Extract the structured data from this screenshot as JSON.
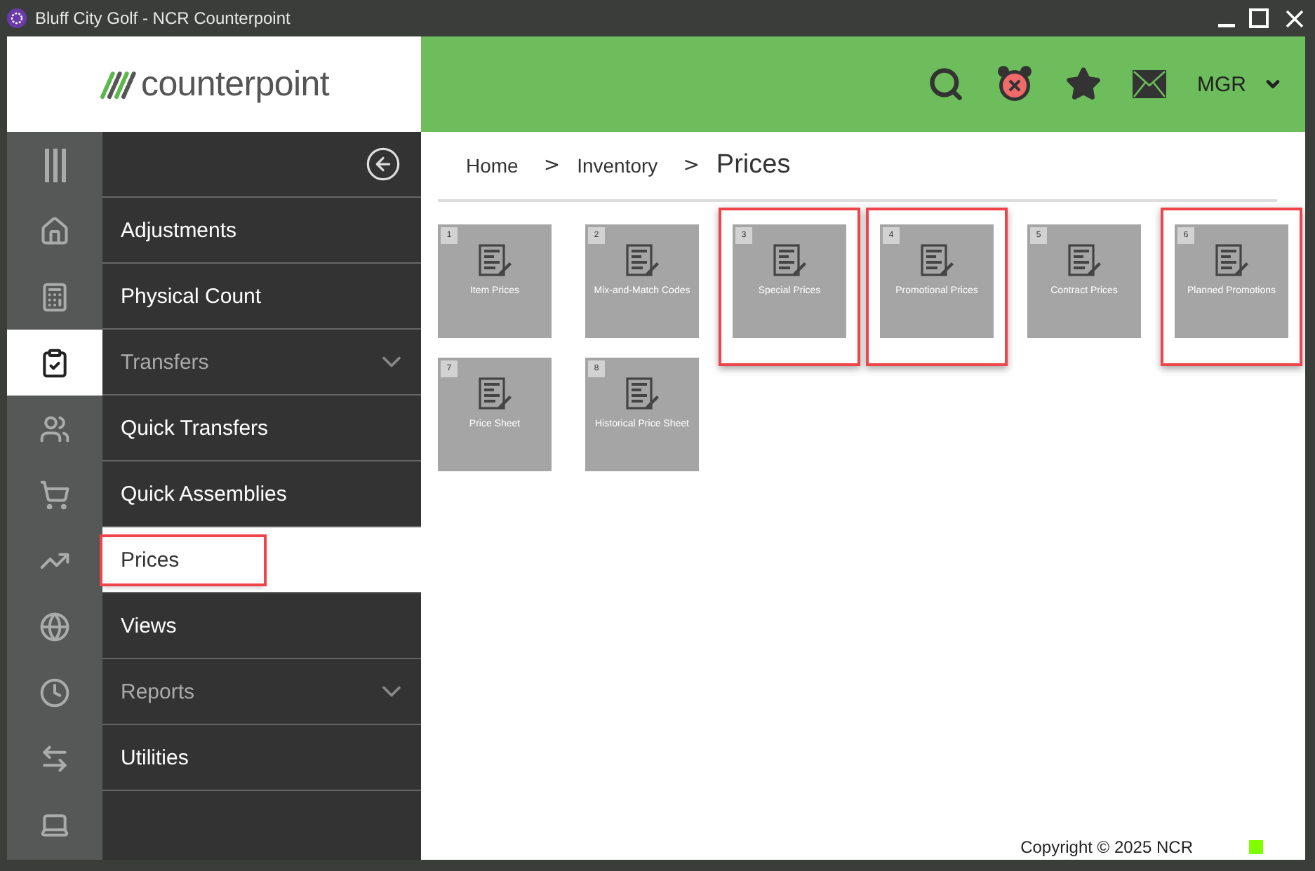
{
  "window": {
    "title": "Bluff City Golf - NCR Counterpoint"
  },
  "header": {
    "logo": "counterpoint",
    "user": "MGR"
  },
  "rail": [
    {
      "kind": "menu",
      "selected": false
    },
    {
      "kind": "home",
      "selected": false
    },
    {
      "kind": "calculator",
      "selected": false
    },
    {
      "kind": "clipboard",
      "selected": true
    },
    {
      "kind": "users",
      "selected": false
    },
    {
      "kind": "cart",
      "selected": false
    },
    {
      "kind": "chart",
      "selected": false
    },
    {
      "kind": "globe",
      "selected": false
    },
    {
      "kind": "clock",
      "selected": false
    },
    {
      "kind": "arrows",
      "selected": false
    },
    {
      "kind": "laptop",
      "selected": false
    }
  ],
  "menu": [
    {
      "label": "Adjustments",
      "kind": "link",
      "selected": false,
      "highlighted": false
    },
    {
      "label": "Physical Count",
      "kind": "link",
      "selected": false,
      "highlighted": false
    },
    {
      "label": "Transfers",
      "kind": "group",
      "expanded": false,
      "selected": false,
      "highlighted": false
    },
    {
      "label": "Quick Transfers",
      "kind": "link",
      "selected": false,
      "highlighted": false
    },
    {
      "label": "Quick Assemblies",
      "kind": "link",
      "selected": false,
      "highlighted": false
    },
    {
      "label": "Prices",
      "kind": "link",
      "selected": true,
      "highlighted": true
    },
    {
      "label": "Views",
      "kind": "link",
      "selected": false,
      "highlighted": false
    },
    {
      "label": "Reports",
      "kind": "group",
      "expanded": false,
      "selected": false,
      "highlighted": false
    },
    {
      "label": "Utilities",
      "kind": "link",
      "selected": false,
      "highlighted": false
    }
  ],
  "breadcrumb": {
    "separator": ">",
    "items": [
      "Home",
      "Inventory",
      "Prices"
    ]
  },
  "tiles": [
    {
      "number": "1",
      "label": "Item Prices",
      "highlighted": false
    },
    {
      "number": "2",
      "label": "Mix-and-Match Codes",
      "highlighted": false
    },
    {
      "number": "3",
      "label": "Special Prices",
      "highlighted": true
    },
    {
      "number": "4",
      "label": "Promotional Prices",
      "highlighted": true
    },
    {
      "number": "5",
      "label": "Contract Prices",
      "highlighted": false
    },
    {
      "number": "6",
      "label": "Planned Promotions",
      "highlighted": true
    },
    {
      "number": "7",
      "label": "Price Sheet",
      "highlighted": false
    },
    {
      "number": "8",
      "label": "Historical Price Sheet",
      "highlighted": false
    }
  ],
  "footer": {
    "copyright": "Copyright © 2025 NCR"
  }
}
